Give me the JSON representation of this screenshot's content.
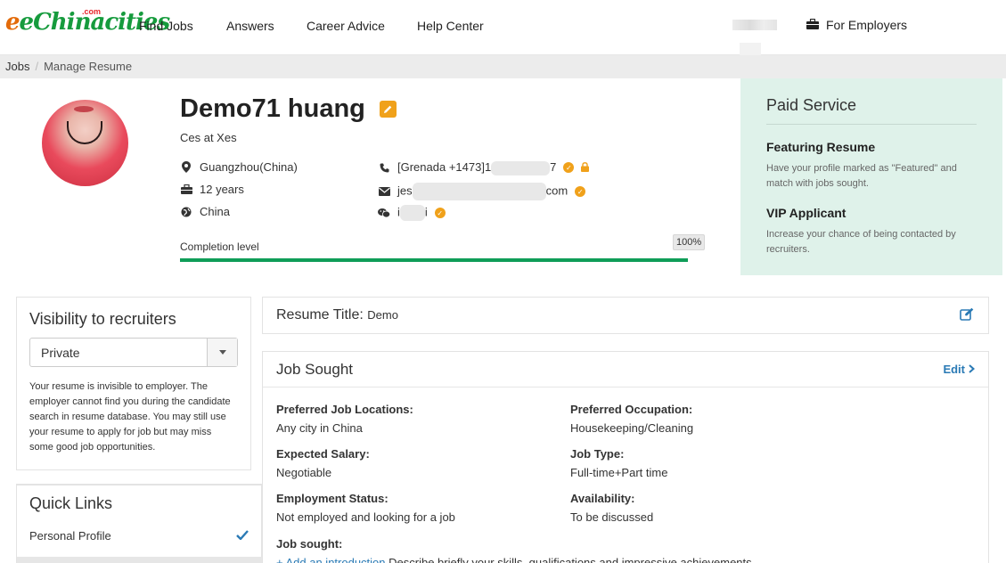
{
  "header": {
    "logo": "eChinacities",
    "logo_suffix": ".com",
    "nav": [
      "Find Jobs",
      "Answers",
      "Career Advice",
      "Help Center"
    ],
    "employers": "For Employers"
  },
  "breadcrumb": {
    "root": "Jobs",
    "current": "Manage Resume"
  },
  "profile": {
    "name": "Demo71 huang",
    "subtitle": "Ces at Xes",
    "location": "Guangzhou(China)",
    "experience": "12 years",
    "country": "China",
    "phone_prefix": "[Grenada +1473]1",
    "phone_suffix": "7",
    "email_prefix": "jes",
    "email_suffix": "com",
    "wechat_prefix": "i",
    "wechat_suffix": "i",
    "completion_label": "Completion level",
    "completion_value": "100%",
    "completion_fraction": 1.0
  },
  "paid": {
    "title": "Paid Service",
    "items": [
      {
        "title": "Featuring Resume",
        "desc": "Have your profile marked as \"Featured\" and match with jobs sought."
      },
      {
        "title": "VIP Applicant",
        "desc": "Increase your chance of being contacted by recruiters."
      }
    ]
  },
  "visibility": {
    "title": "Visibility to recruiters",
    "selected": "Private",
    "desc": "Your resume is invisible to employer. The employer cannot find you during the candidate search in resume database. You may still use your resume to apply for job but may miss some good job opportunities."
  },
  "quick_links": {
    "title": "Quick Links",
    "items": [
      "Personal Profile"
    ]
  },
  "resume_title": {
    "label": "Resume Title:",
    "value": "Demo"
  },
  "job_sought": {
    "title": "Job Sought",
    "edit": "Edit",
    "fields": [
      {
        "label": "Preferred Job Locations:",
        "value": "Any city in China"
      },
      {
        "label": "Preferred Occupation:",
        "value": "Housekeeping/Cleaning"
      },
      {
        "label": "Expected Salary:",
        "value": "Negotiable"
      },
      {
        "label": "Job Type:",
        "value": "Full-time+Part time"
      },
      {
        "label": "Employment Status:",
        "value": "Not employed and looking for a job"
      },
      {
        "label": "Availability:",
        "value": "To be discussed"
      }
    ],
    "sought_label": "Job sought:",
    "intro_link": "+ Add an introduction",
    "intro_text": "Describe briefly your skills, qualifications and impressive achievements"
  },
  "colors": {
    "brand_green": "#169b3d",
    "accent_orange": "#f0a11a",
    "link_blue": "#2a7ab5",
    "progress": "#0f9d58"
  }
}
